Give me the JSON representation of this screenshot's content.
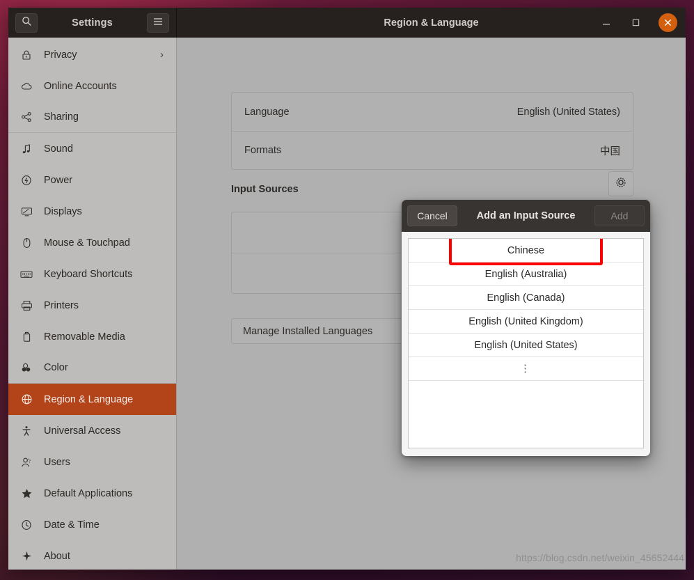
{
  "window": {
    "app_title": "Settings",
    "page_title": "Region & Language",
    "search_icon": "search-icon",
    "menu_icon": "hamburger-menu-icon",
    "minimize_label": "–",
    "maximize_label": "▢",
    "close_label": "✕",
    "close_color": "#d2600f"
  },
  "sidebar": {
    "selected": "Region & Language",
    "accent_color": "#b34318",
    "items": [
      {
        "label": "Privacy",
        "icon": "lock-icon",
        "chevron": "›"
      },
      {
        "label": "Online Accounts",
        "icon": "cloud-icon"
      },
      {
        "label": "Sharing",
        "icon": "share-nodes-icon"
      },
      {
        "label": "Sound",
        "icon": "music-note-icon"
      },
      {
        "label": "Power",
        "icon": "power-icon"
      },
      {
        "label": "Displays",
        "icon": "monitor-icon"
      },
      {
        "label": "Mouse & Touchpad",
        "icon": "mouse-icon"
      },
      {
        "label": "Keyboard Shortcuts",
        "icon": "keyboard-icon"
      },
      {
        "label": "Printers",
        "icon": "printer-icon"
      },
      {
        "label": "Removable Media",
        "icon": "usb-drive-icon"
      },
      {
        "label": "Color",
        "icon": "color-circles-icon"
      },
      {
        "label": "Region & Language",
        "icon": "globe-icon"
      },
      {
        "label": "Universal Access",
        "icon": "accessibility-icon"
      },
      {
        "label": "Users",
        "icon": "users-icon"
      },
      {
        "label": "Default Applications",
        "icon": "star-icon"
      },
      {
        "label": "Date & Time",
        "icon": "clock-icon"
      },
      {
        "label": "About",
        "icon": "sparkle-icon"
      }
    ]
  },
  "main": {
    "language_card": [
      {
        "label": "Language",
        "value": "English (United States)"
      },
      {
        "label": "Formats",
        "value": "中国"
      }
    ],
    "input_sources_heading": "Input Sources",
    "gear_icon": "gear-icon",
    "input_rows": [
      {
        "label": "",
        "show_icon": "eye-icon",
        "delete_icon": "trash-icon"
      },
      {
        "label": ""
      }
    ],
    "manage_button": "Manage Installed Languages"
  },
  "dialog": {
    "cancel_label": "Cancel",
    "title": "Add an Input Source",
    "add_label": "Add",
    "add_disabled": true,
    "highlight_color": "#fe0000",
    "items": [
      {
        "label": "Chinese",
        "highlighted": true
      },
      {
        "label": "English (Australia)",
        "highlighted": false
      },
      {
        "label": "English (Canada)",
        "highlighted": false
      },
      {
        "label": "English (United Kingdom)",
        "highlighted": false
      },
      {
        "label": "English (United States)",
        "highlighted": false
      },
      {
        "label": "⋮",
        "highlighted": false,
        "ellipsis": true
      }
    ]
  },
  "watermark": "https://blog.csdn.net/weixin_45652444"
}
